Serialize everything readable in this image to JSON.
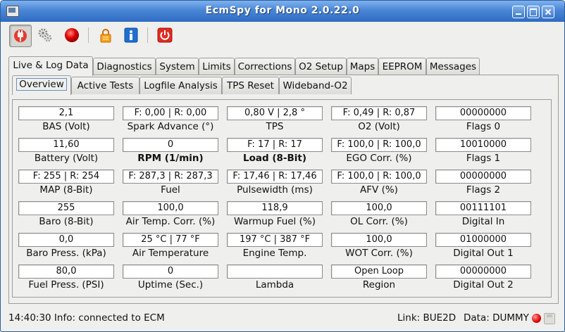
{
  "window": {
    "title": "EcmSpy for Mono 2.0.22.0",
    "controls": [
      "minimize",
      "maximize",
      "close"
    ]
  },
  "toolbar": {
    "buttons": [
      {
        "icon": "plug-connect-icon",
        "pressed": true
      },
      {
        "icon": "gears-icon",
        "pressed": false
      },
      {
        "icon": "record-red-icon",
        "pressed": false
      },
      {
        "icon": "lock-icon",
        "pressed": false
      },
      {
        "icon": "info-icon",
        "pressed": false
      },
      {
        "icon": "power-icon",
        "pressed": false
      }
    ]
  },
  "main_tabs": [
    "Live & Log Data",
    "Diagnostics",
    "System",
    "Limits",
    "Corrections",
    "O2 Setup",
    "Maps",
    "EEPROM",
    "Messages"
  ],
  "main_tab_active": 0,
  "sub_tabs": [
    "Overview",
    "Active Tests",
    "Logfile Analysis",
    "TPS Reset",
    "Wideband-O2"
  ],
  "sub_tab_active": 0,
  "grid": [
    [
      {
        "value": "2,1",
        "label": "BAS (Volt)"
      },
      {
        "value": "F: 0,00 | R: 0,00",
        "label": "Spark Advance (°)"
      },
      {
        "value": "0,80 V | 2,8 °",
        "label": "TPS"
      },
      {
        "value": "F: 0,49 | R: 0,87",
        "label": "O2 (Volt)"
      },
      {
        "value": "00000000",
        "label": "Flags 0"
      }
    ],
    [
      {
        "value": "11,60",
        "label": "Battery (Volt)"
      },
      {
        "value": "0",
        "label": "RPM (1/min)",
        "bold": true
      },
      {
        "value": "F: 17 | R: 17",
        "label": "Load (8-Bit)",
        "bold": true
      },
      {
        "value": "F: 100,0 | R: 100,0",
        "label": "EGO Corr. (%)"
      },
      {
        "value": "10010000",
        "label": "Flags 1"
      }
    ],
    [
      {
        "value": "F: 255 | R: 254",
        "label": "MAP (8-Bit)"
      },
      {
        "value": "F: 287,3 | R: 287,3",
        "label": "Fuel"
      },
      {
        "value": "F: 17,46 | R: 17,46",
        "label": "Pulsewidth (ms)"
      },
      {
        "value": "F: 100,0 | R: 100,0",
        "label": "AFV (%)"
      },
      {
        "value": "00000000",
        "label": "Flags 2"
      }
    ],
    [
      {
        "value": "255",
        "label": "Baro (8-Bit)"
      },
      {
        "value": "100,0",
        "label": "Air Temp. Corr. (%)"
      },
      {
        "value": "118,9",
        "label": "Warmup Fuel (%)"
      },
      {
        "value": "100,0",
        "label": "OL Corr. (%)"
      },
      {
        "value": "00111101",
        "label": "Digital In"
      }
    ],
    [
      {
        "value": "0,0",
        "label": "Baro Press. (kPa)"
      },
      {
        "value": "25 °C | 77 °F",
        "label": "Air Temperature"
      },
      {
        "value": "197 °C | 387 °F",
        "label": "Engine Temp."
      },
      {
        "value": "100,0",
        "label": "WOT Corr. (%)"
      },
      {
        "value": "01000000",
        "label": "Digital Out 1"
      }
    ],
    [
      {
        "value": "80,0",
        "label": "Fuel Press. (PSI)"
      },
      {
        "value": "0",
        "label": "Uptime (Sec.)"
      },
      {
        "value": "",
        "label": "Lambda"
      },
      {
        "value": "Open Loop",
        "label": "Region"
      },
      {
        "value": "00000000",
        "label": "Digital Out 2"
      }
    ]
  ],
  "status": {
    "message": "14:40:30 Info: connected to ECM",
    "link": "Link: BUE2D",
    "data": "Data: DUMMY",
    "led_color": "#e00000"
  }
}
